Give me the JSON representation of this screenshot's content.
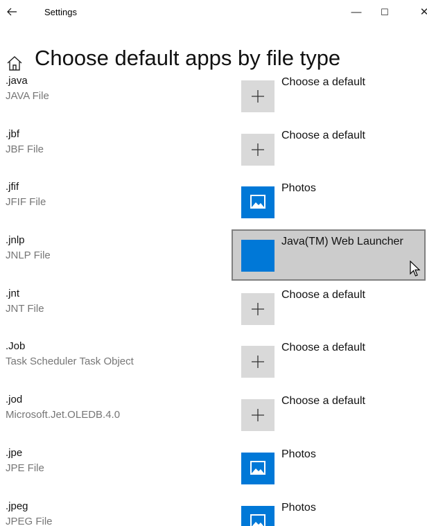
{
  "window": {
    "back_icon": "arrow-left-icon",
    "app_title": "Settings",
    "minimize_glyph": "—",
    "maximize_glyph": "☐",
    "close_glyph": "✕"
  },
  "header": {
    "home_icon": "home-icon",
    "title": "Choose default apps by file type"
  },
  "rows": [
    {
      "ext": ".java",
      "desc": "JAVA File",
      "app": "Choose a default",
      "tile": "plus"
    },
    {
      "ext": ".jbf",
      "desc": "JBF File",
      "app": "Choose a default",
      "tile": "plus"
    },
    {
      "ext": ".jfif",
      "desc": "JFIF File",
      "app": "Photos",
      "tile": "photos"
    },
    {
      "ext": ".jnlp",
      "desc": "JNLP File",
      "app": "Java(TM) Web Launcher",
      "tile": "blank-blue",
      "hovered": true
    },
    {
      "ext": ".jnt",
      "desc": "JNT File",
      "app": "Choose a default",
      "tile": "plus"
    },
    {
      "ext": ".Job",
      "desc": "Task Scheduler Task Object",
      "app": "Choose a default",
      "tile": "plus"
    },
    {
      "ext": ".jod",
      "desc": "Microsoft.Jet.OLEDB.4.0",
      "app": "Choose a default",
      "tile": "plus"
    },
    {
      "ext": ".jpe",
      "desc": "JPE File",
      "app": "Photos",
      "tile": "photos"
    },
    {
      "ext": ".jpeg",
      "desc": "JPEG File",
      "app": "Photos",
      "tile": "photos"
    }
  ],
  "colors": {
    "accent": "#0078d7",
    "tile_gray": "#d9d9d9",
    "hover_bg": "#cccccc",
    "hover_border": "#808080",
    "desc_text": "#767676"
  }
}
